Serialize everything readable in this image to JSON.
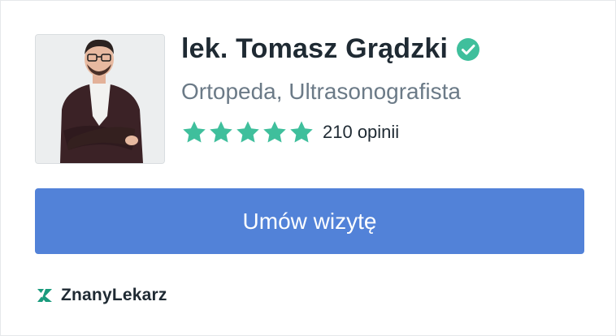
{
  "doctor": {
    "name": "lek. Tomasz Grądzki",
    "specialties": "Ortopeda, Ultrasonografista",
    "verified": true,
    "rating": 5,
    "rating_max": 5,
    "reviews_label": "210 opinii"
  },
  "cta": {
    "label": "Umów wizytę"
  },
  "brand": {
    "name": "ZnanyLekarz"
  },
  "colors": {
    "accent": "#5282d8",
    "star": "#3fbf9c",
    "verified": "#3fbf9c",
    "text_primary": "#1f2a33",
    "text_secondary": "#6b7a87"
  },
  "icons": {
    "verified": "check-badge-icon",
    "star": "star-icon",
    "brand": "znanylekarz-logo-icon"
  }
}
